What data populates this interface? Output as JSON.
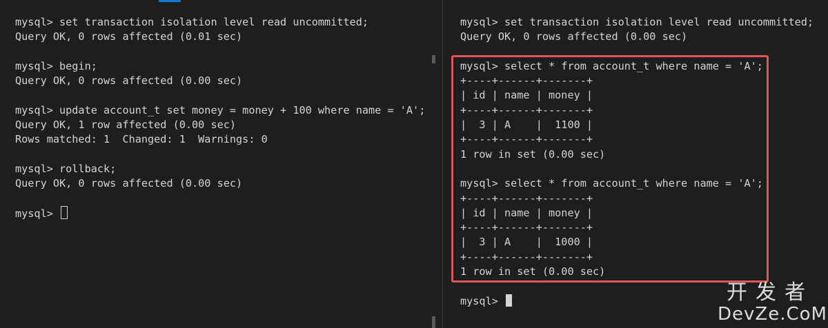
{
  "left_terminal": {
    "lines": [
      "mysql> set transaction isolation level read uncommitted;",
      "Query OK, 0 rows affected (0.01 sec)",
      "",
      "mysql> begin;",
      "Query OK, 0 rows affected (0.00 sec)",
      "",
      "mysql> update account_t set money = money + 100 where name = 'A';",
      "Query OK, 1 row affected (0.00 sec)",
      "Rows matched: 1  Changed: 1  Warnings: 0",
      "",
      "mysql> rollback;",
      "Query OK, 0 rows affected (0.00 sec)",
      ""
    ],
    "prompt": "mysql> "
  },
  "right_terminal": {
    "lines": [
      "mysql> set transaction isolation level read uncommitted;",
      "Query OK, 0 rows affected (0.00 sec)",
      "",
      "mysql> select * from account_t where name = 'A';",
      "+----+------+-------+",
      "| id | name | money |",
      "+----+------+-------+",
      "|  3 | A    |  1100 |",
      "+----+------+-------+",
      "1 row in set (0.00 sec)",
      "",
      "mysql> select * from account_t where name = 'A';",
      "+----+------+-------+",
      "| id | name | money |",
      "+----+------+-------+",
      "|  3 | A    |  1000 |",
      "+----+------+-------+",
      "1 row in set (0.00 sec)",
      ""
    ],
    "prompt": "mysql> "
  },
  "watermark": {
    "cn": "开发者",
    "en": "DevZe.CoM"
  },
  "colors": {
    "background": "#1e1e1e",
    "text": "#d4d4d4",
    "highlight": "#e05656",
    "accent": "#0e7ad1"
  }
}
